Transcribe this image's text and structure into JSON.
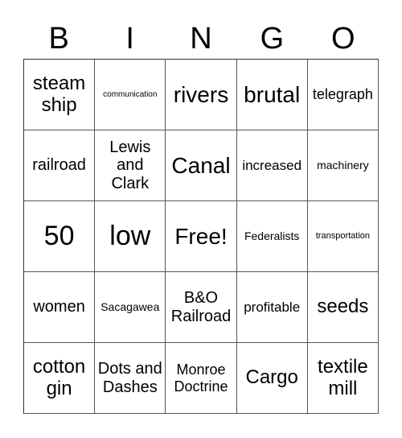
{
  "header": [
    "B",
    "I",
    "N",
    "G",
    "O"
  ],
  "cells": [
    {
      "text": "steam ship",
      "size": "s-l"
    },
    {
      "text": "communication",
      "size": "s-tiny"
    },
    {
      "text": "rivers",
      "size": "s-xl"
    },
    {
      "text": "brutal",
      "size": "s-xl"
    },
    {
      "text": "telegraph",
      "size": "s-ms"
    },
    {
      "text": "railroad",
      "size": "s-m"
    },
    {
      "text": "Lewis and Clark",
      "size": "s-m"
    },
    {
      "text": "Canal",
      "size": "s-xl"
    },
    {
      "text": "increased",
      "size": "s-s"
    },
    {
      "text": "machinery",
      "size": "s-xs"
    },
    {
      "text": "50",
      "size": "s-xxl"
    },
    {
      "text": "low",
      "size": "s-xxl"
    },
    {
      "text": "Free!",
      "size": "s-xl"
    },
    {
      "text": "Federalists",
      "size": "s-xs"
    },
    {
      "text": "transportation",
      "size": "s-xxs"
    },
    {
      "text": "women",
      "size": "s-m"
    },
    {
      "text": "Sacagawea",
      "size": "s-xs"
    },
    {
      "text": "B&O Railroad",
      "size": "s-m"
    },
    {
      "text": "profitable",
      "size": "s-s"
    },
    {
      "text": "seeds",
      "size": "s-l"
    },
    {
      "text": "cotton gin",
      "size": "s-l"
    },
    {
      "text": "Dots and Dashes",
      "size": "s-m"
    },
    {
      "text": "Monroe Doctrine",
      "size": "s-ms"
    },
    {
      "text": "Cargo",
      "size": "s-l"
    },
    {
      "text": "textile mill",
      "size": "s-l"
    }
  ]
}
